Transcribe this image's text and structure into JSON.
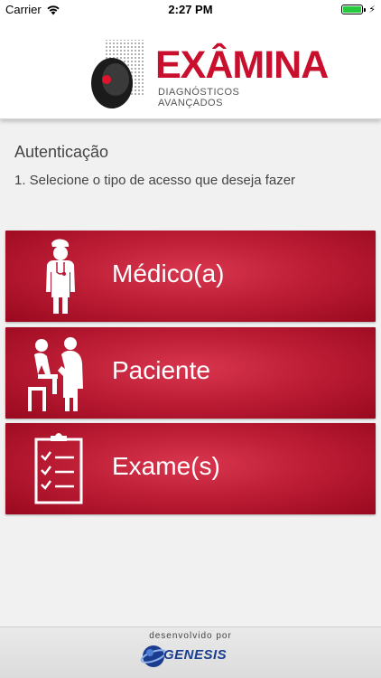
{
  "status_bar": {
    "carrier": "Carrier",
    "time": "2:27 PM",
    "wifi_icon": "wifi-icon",
    "battery_icon": "battery-icon"
  },
  "header": {
    "logo_name": "EXÂMINA",
    "logo_subtitle": "DIAGNÓSTICOS AVANÇADOS"
  },
  "auth": {
    "title": "Autenticação",
    "instruction": "1. Selecione o tipo de acesso que deseja fazer"
  },
  "access_options": [
    {
      "label": "Médico(a)",
      "icon": "doctor-icon"
    },
    {
      "label": "Paciente",
      "icon": "patient-exam-icon"
    },
    {
      "label": "Exame(s)",
      "icon": "clipboard-checklist-icon"
    }
  ],
  "footer": {
    "developed_by": "desenvolvido por",
    "developer": "GENESIS"
  },
  "colors": {
    "brand_red": "#c8102e",
    "button_red": "#b81a32",
    "developer_blue": "#1a3d8f"
  }
}
